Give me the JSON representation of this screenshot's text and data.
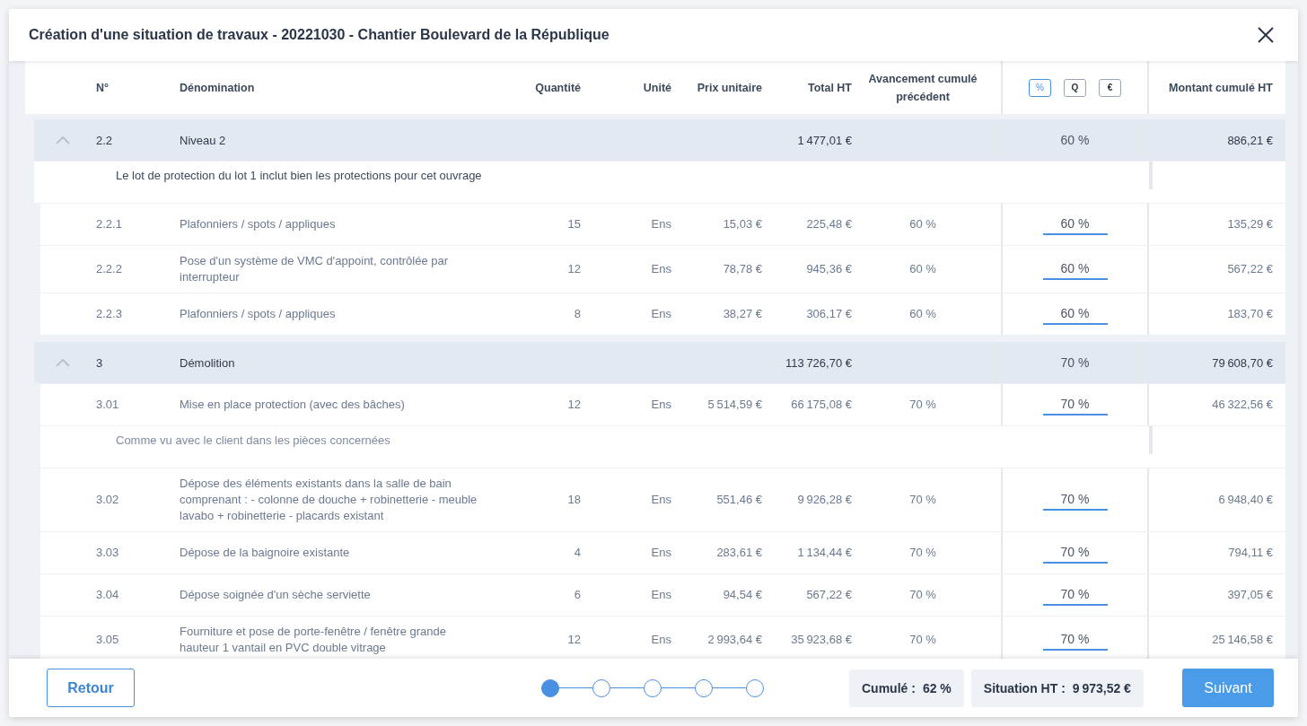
{
  "window": {
    "title": "Création d'une situation de travaux - 20221030 - Chantier Boulevard de la République"
  },
  "table": {
    "columns": {
      "number": "N°",
      "name": "Dénomination",
      "quantity": "Quantité",
      "unit": "Unité",
      "unit_price": "Prix unitaire",
      "total": "Total HT",
      "previous": "Avancement cumulé précédent",
      "amount": "Montant cumulé HT"
    },
    "modes": [
      {
        "label": "%",
        "selected": true
      },
      {
        "label": "Q",
        "selected": false
      },
      {
        "label": "€",
        "selected": false
      }
    ],
    "groups": [
      {
        "number": "2.2",
        "name": "Niveau 2",
        "total": "1 477,01 €",
        "progress": "60 %",
        "amount": "886,21 €",
        "expanded": true,
        "note": "Le lot de protection du lot 1 inclut bien les protections pour cet ouvrage",
        "children": [
          {
            "number": "2.2.1",
            "name": "Plafonniers / spots / appliques",
            "quantity": "15",
            "unit": "Ens",
            "unit_price": "15,03 €",
            "total": "225,48 €",
            "previous": "60 %",
            "progress": "60 %",
            "amount": "135,29 €"
          },
          {
            "number": "2.2.2",
            "name": "Pose d'un système de VMC d'appoint, contrôlée par interrupteur",
            "quantity": "12",
            "unit": "Ens",
            "unit_price": "78,78 €",
            "total": "945,36 €",
            "previous": "60 %",
            "progress": "60 %",
            "amount": "567,22 €"
          },
          {
            "number": "2.2.3",
            "name": "Plafonniers / spots / appliques",
            "quantity": "8",
            "unit": "Ens",
            "unit_price": "38,27 €",
            "total": "306,17 €",
            "previous": "60 %",
            "progress": "60 %",
            "amount": "183,70 €"
          }
        ]
      },
      {
        "number": "3",
        "name": "Démolition",
        "total": "113 726,70 €",
        "progress": "70 %",
        "amount": "79 608,70 €",
        "expanded": true,
        "children": [
          {
            "number": "3.01",
            "name": "Mise en place protection (avec des bâches)",
            "quantity": "12",
            "unit": "Ens",
            "unit_price": "5 514,59 €",
            "total": "66 175,08 €",
            "previous": "70 %",
            "progress": "70 %",
            "amount": "46 322,56 €",
            "note": "Comme vu avec le client dans les pièces concernées"
          },
          {
            "number": "3.02",
            "name": "Dépose des éléments existants dans la salle de bain comprenant : - colonne de douche + robinetterie - meuble lavabo + robinetterie - placards existant",
            "quantity": "18",
            "unit": "Ens",
            "unit_price": "551,46 €",
            "total": "9 926,28 €",
            "previous": "70 %",
            "progress": "70 %",
            "amount": "6 948,40 €"
          },
          {
            "number": "3.03",
            "name": "Dépose de la baignoire existante",
            "quantity": "4",
            "unit": "Ens",
            "unit_price": "283,61 €",
            "total": "1 134,44 €",
            "previous": "70 %",
            "progress": "70 %",
            "amount": "794,11 €"
          },
          {
            "number": "3.04",
            "name": "Dépose soignée d'un sèche serviette",
            "quantity": "6",
            "unit": "Ens",
            "unit_price": "94,54 €",
            "total": "567,22 €",
            "previous": "70 %",
            "progress": "70 %",
            "amount": "397,05 €"
          },
          {
            "number": "3.05",
            "name": "Fourniture et pose de porte-fenêtre / fenêtre grande hauteur 1 vantail en PVC double vitrage",
            "quantity": "12",
            "unit": "Ens",
            "unit_price": "2 993,64 €",
            "total": "35 923,68 €",
            "previous": "70 %",
            "progress": "70 %",
            "amount": "25 146,58 €"
          }
        ]
      }
    ]
  },
  "footer": {
    "back": "Retour",
    "steps": [
      {
        "selected": true
      },
      {
        "selected": false
      },
      {
        "selected": false
      },
      {
        "selected": false
      },
      {
        "selected": false
      }
    ],
    "summary": [
      {
        "label": "Cumulé :",
        "value": "62 %"
      },
      {
        "label": "Situation HT :",
        "value": "9 973,52 €"
      }
    ],
    "next": "Suivant"
  }
}
